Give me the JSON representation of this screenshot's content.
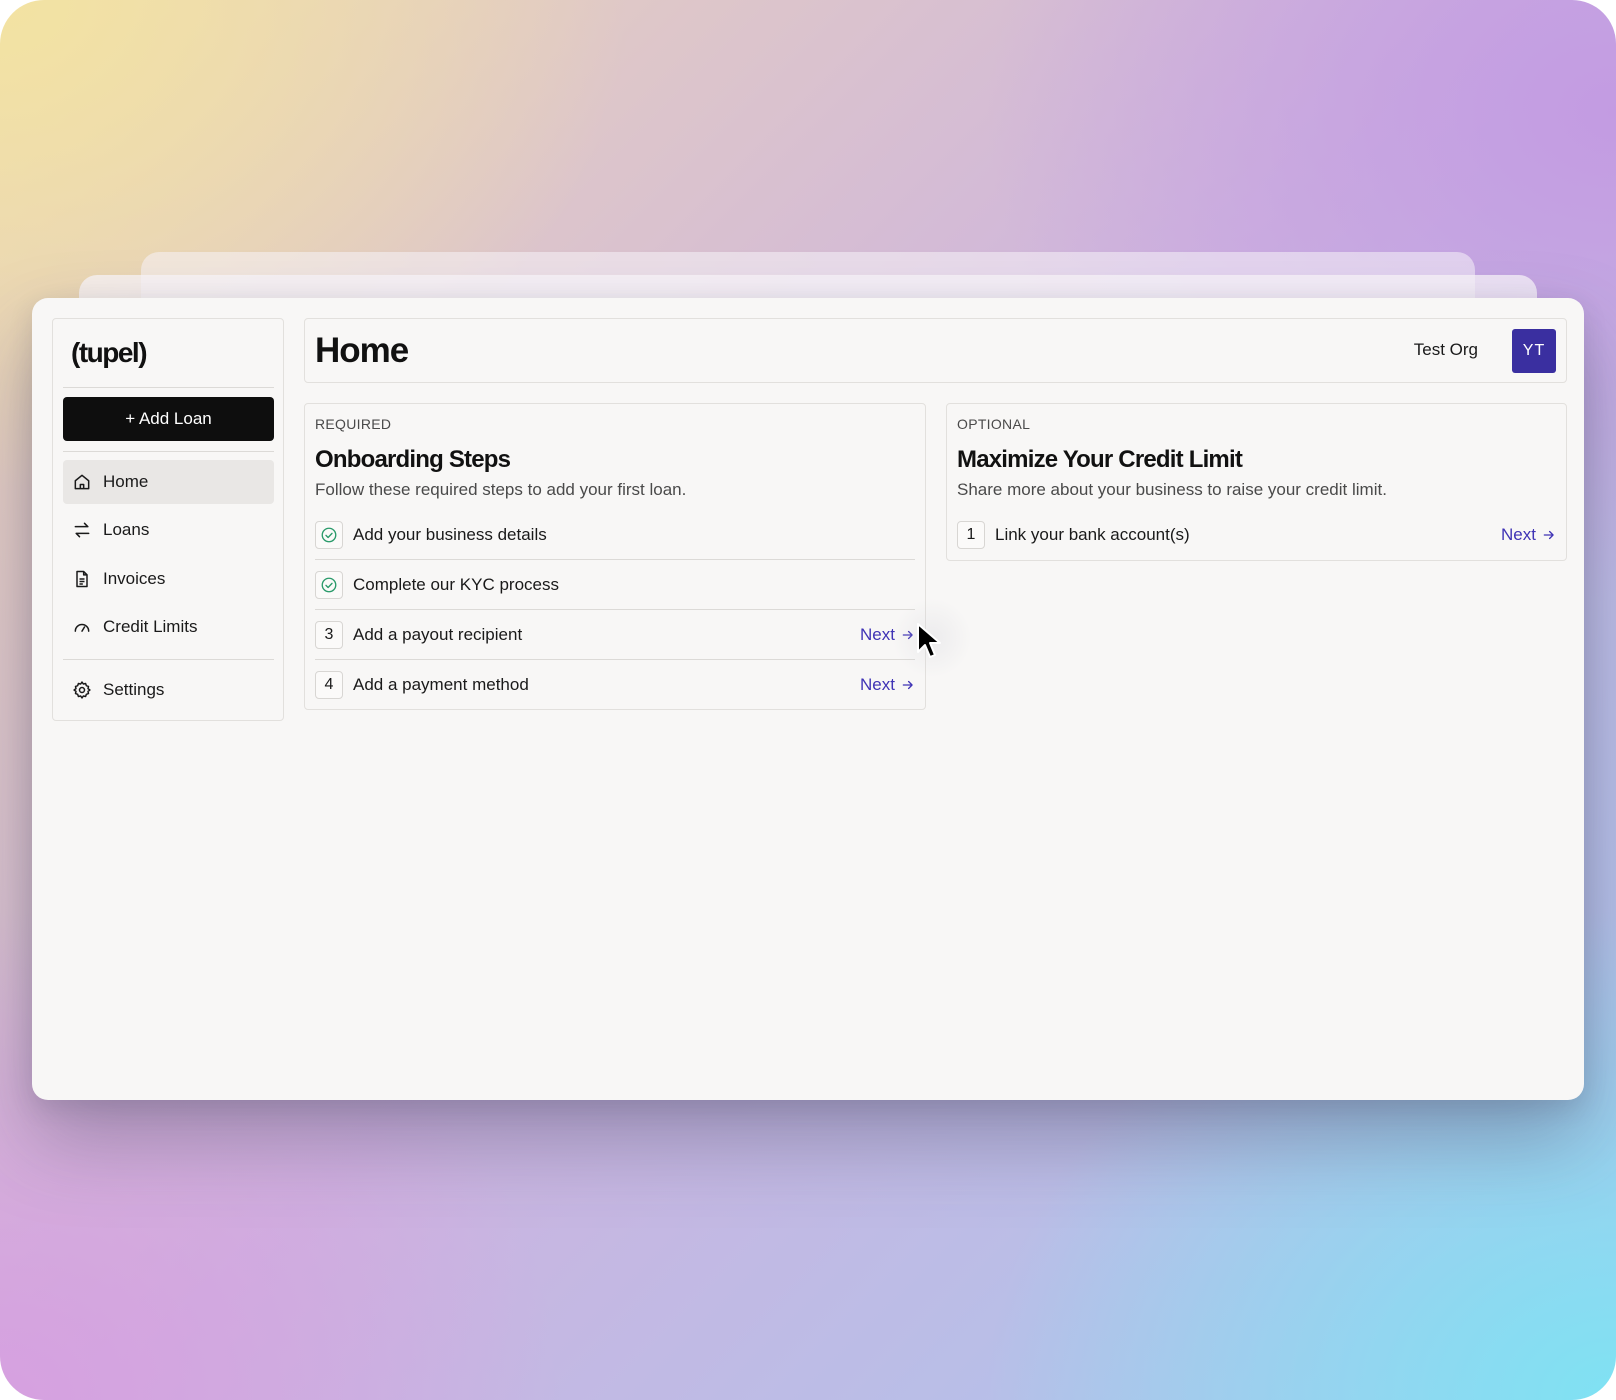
{
  "brand": {
    "logo_text": "(tupel)"
  },
  "sidebar": {
    "add_loan_label": "+ Add Loan",
    "items": [
      {
        "label": "Home",
        "icon": "home-icon",
        "active": true
      },
      {
        "label": "Loans",
        "icon": "arrows-exchange-icon",
        "active": false
      },
      {
        "label": "Invoices",
        "icon": "document-icon",
        "active": false
      },
      {
        "label": "Credit Limits",
        "icon": "gauge-icon",
        "active": false
      }
    ],
    "settings": {
      "label": "Settings",
      "icon": "gear-icon"
    }
  },
  "header": {
    "title": "Home",
    "org_name": "Test Org",
    "avatar_initials": "YT"
  },
  "onboarding": {
    "eyebrow": "REQUIRED",
    "title": "Onboarding Steps",
    "subtitle": "Follow these required steps to add your first loan.",
    "steps": [
      {
        "badge": "",
        "status": "complete",
        "label": "Add your business details",
        "action": ""
      },
      {
        "badge": "",
        "status": "complete",
        "label": "Complete our KYC process",
        "action": ""
      },
      {
        "badge": "3",
        "status": "pending",
        "label": "Add a payout recipient",
        "action": "Next"
      },
      {
        "badge": "4",
        "status": "pending",
        "label": "Add a payment method",
        "action": "Next"
      }
    ]
  },
  "credit": {
    "eyebrow": "OPTIONAL",
    "title": "Maximize Your Credit Limit",
    "subtitle": "Share more about your business to raise your credit limit.",
    "steps": [
      {
        "badge": "1",
        "status": "pending",
        "label": "Link your bank account(s)",
        "action": "Next"
      }
    ]
  },
  "colors": {
    "accent": "#3f33b5",
    "avatar_bg": "#3a2fa0",
    "check_green": "#2a9a6a",
    "primary_button": "#0e0e0e"
  }
}
